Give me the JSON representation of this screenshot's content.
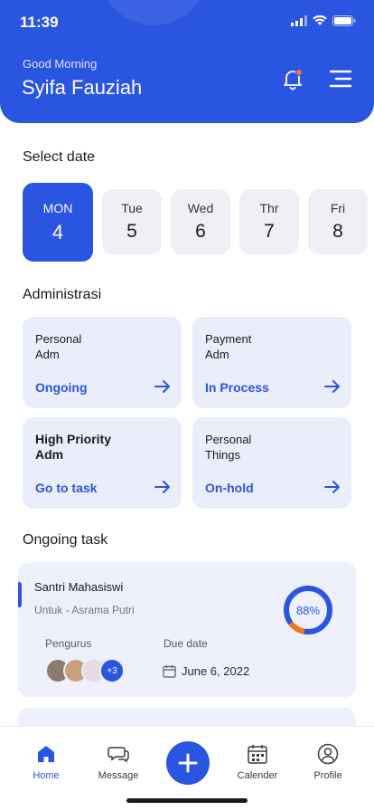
{
  "status": {
    "time": "11:39"
  },
  "header": {
    "greeting": "Good Morning",
    "name": "Syifa Fauziah"
  },
  "select_date": {
    "title": "Select date",
    "days": [
      {
        "day": "MON",
        "num": "4",
        "selected": true
      },
      {
        "day": "Tue",
        "num": "5"
      },
      {
        "day": "Wed",
        "num": "6"
      },
      {
        "day": "Thr",
        "num": "7"
      },
      {
        "day": "Fri",
        "num": "8"
      }
    ]
  },
  "administrasi": {
    "title": "Administrasi",
    "cards": [
      {
        "line1": "Personal",
        "line2": "Adm",
        "status": "Ongoing"
      },
      {
        "line1": "Payment",
        "line2": "Adm",
        "status": "In Process"
      },
      {
        "line1": "High Priority",
        "line2": "Adm",
        "status": "Go to task"
      },
      {
        "line1": "Personal",
        "line2": "Things",
        "status": "On-hold"
      }
    ]
  },
  "ongoing": {
    "title": "Ongoing task",
    "task": {
      "title": "Santri Mahasiswi",
      "subtitle": "Untuk - Asrama Putri",
      "progress_label": "88%",
      "progress": 0.88,
      "pengurus_label": "Pengurus",
      "more_count": "+3",
      "due_label": "Due date",
      "due_date": "June 6, 2022"
    }
  },
  "tabs": [
    {
      "label": "Home",
      "icon": "home-icon"
    },
    {
      "label": "Message",
      "icon": "message-icon"
    },
    {
      "label": "Calender",
      "icon": "calendar-icon"
    },
    {
      "label": "Profile",
      "icon": "profile-icon"
    }
  ],
  "colors": {
    "primary": "#2a55e0",
    "card": "#eaeefb",
    "progress_track": "#2a55e0",
    "progress_fill": "#f07a1a"
  }
}
